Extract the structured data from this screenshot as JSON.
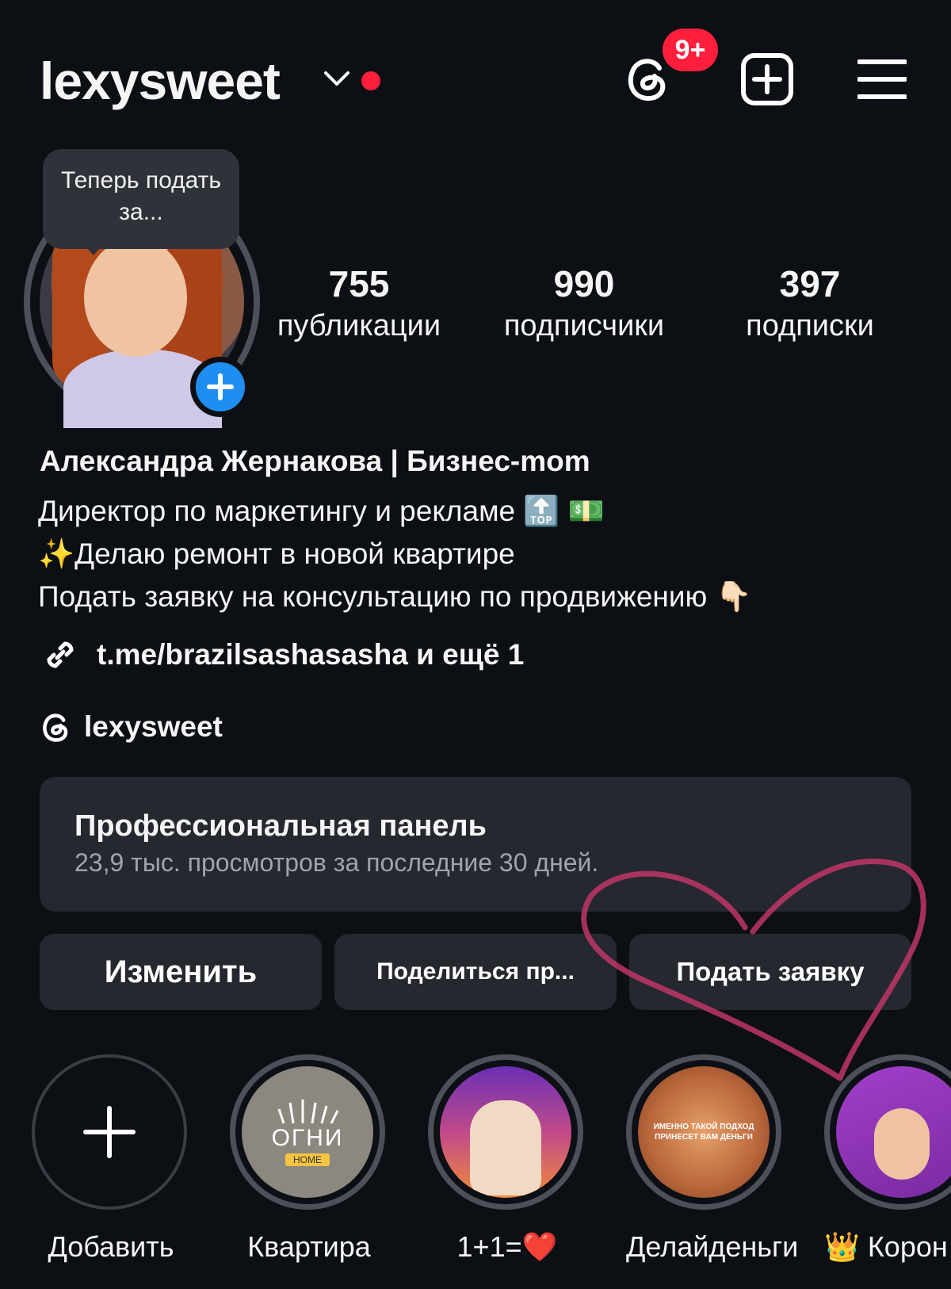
{
  "header": {
    "username": "lexysweet",
    "notification_count": "9+"
  },
  "profile": {
    "tooltip": "Теперь подать за...",
    "stats": [
      {
        "value": "755",
        "label": "публикации"
      },
      {
        "value": "990",
        "label": "подписчики"
      },
      {
        "value": "397",
        "label": "подписки"
      }
    ],
    "name": "Александра Жернакова | Бизнес-mom",
    "bio_lines": [
      "Директор по маркетингу и рекламе 🔝 💵",
      "✨Делаю ремонт в новой квартире",
      "Подать заявку на консультацию по продвижению 👇🏻"
    ],
    "link": "t.me/brazilsashasasha и ещё 1",
    "threads_handle": "lexysweet"
  },
  "pro_panel": {
    "title": "Профессиональная панель",
    "subtitle": "23,9 тыс. просмотров за последние 30 дней."
  },
  "buttons": {
    "edit": "Изменить",
    "share": "Поделиться пр...",
    "apply": "Подать заявку"
  },
  "highlights": [
    {
      "label": "Добавить"
    },
    {
      "label": "Квартира",
      "cover_text": "ОГНИ",
      "cover_badge": "HOME"
    },
    {
      "label": "1+1=❤️"
    },
    {
      "label": "Делайденьги",
      "cover_text": "ИМЕННО ТАКОЙ ПОДХОД ПРИНЕСЕТ ВАМ ДЕНЬГИ"
    },
    {
      "label": "👑 Корон"
    }
  ],
  "colors": {
    "background": "#0c0f14",
    "card": "#25282e",
    "accent_blue": "#1f8ef1",
    "badge_red": "#ff1f3d",
    "heart_drawing": "#c0356a"
  }
}
